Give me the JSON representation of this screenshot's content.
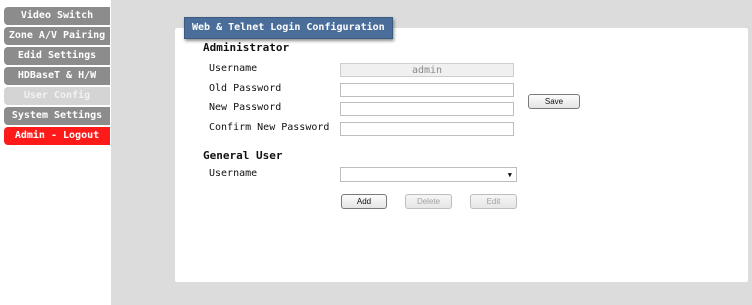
{
  "sidebar": {
    "items": [
      {
        "label": "Video Switch"
      },
      {
        "label": "Zone A/V Pairing"
      },
      {
        "label": "Edid Settings"
      },
      {
        "label": "HDBaseT & H/W"
      },
      {
        "label": "User Config"
      },
      {
        "label": "System Settings"
      },
      {
        "label": "Admin - Logout"
      }
    ]
  },
  "panel": {
    "title": "Web & Telnet Login Configuration",
    "administrator": {
      "heading": "Administrator",
      "username_label": "Username",
      "username_value": "admin",
      "old_password_label": "Old Password",
      "new_password_label": "New Password",
      "confirm_password_label": "Confirm New Password",
      "save_label": "Save"
    },
    "general_user": {
      "heading": "General User",
      "username_label": "Username",
      "username_selected": "",
      "add_label": "Add",
      "delete_label": "Delete",
      "edit_label": "Edit"
    }
  },
  "colors": {
    "nav_default": "#8c8c8c",
    "nav_active": "#d4d4d4",
    "nav_logout": "#ff1a1a",
    "title_bar": "#4a6d9a",
    "main_background": "#dcdcdc"
  }
}
